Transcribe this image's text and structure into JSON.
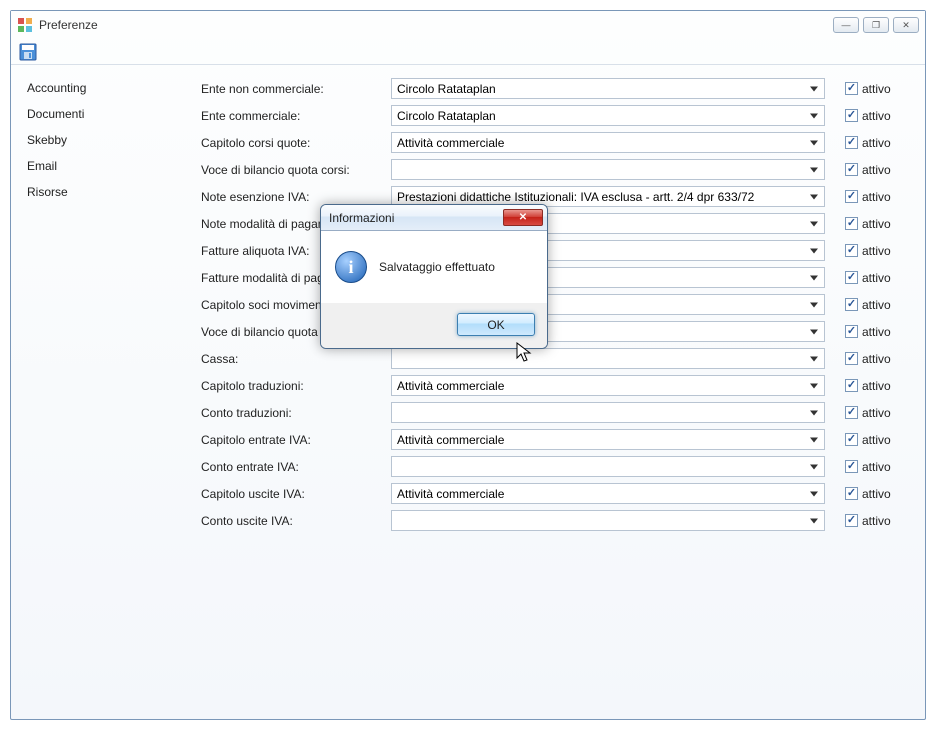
{
  "window": {
    "title": "Preferenze"
  },
  "sidebar": {
    "items": [
      {
        "label": "Accounting"
      },
      {
        "label": "Documenti"
      },
      {
        "label": "Skebby"
      },
      {
        "label": "Email"
      },
      {
        "label": "Risorse"
      }
    ]
  },
  "form": {
    "attivo_label": "attivo",
    "rows": [
      {
        "label": "Ente non commerciale:",
        "value": "Circolo Ratataplan"
      },
      {
        "label": "Ente commerciale:",
        "value": "Circolo Ratataplan"
      },
      {
        "label": "Capitolo corsi quote:",
        "value": "Attività commerciale"
      },
      {
        "label": "Voce di bilancio quota corsi:",
        "value": ""
      },
      {
        "label": "Note esenzione IVA:",
        "value": "Prestazioni didattiche Istituzionali: IVA esclusa - artt. 2/4 dpr 633/72"
      },
      {
        "label": "Note modalità di pagamento:",
        "value": ""
      },
      {
        "label": "Fatture aliquota IVA:",
        "value": ""
      },
      {
        "label": "Fatture modalità di pagamento:",
        "value": ""
      },
      {
        "label": "Capitolo soci movimenti:",
        "value": ""
      },
      {
        "label": "Voce di bilancio quota associativa:",
        "value": ""
      },
      {
        "label": "Cassa:",
        "value": ""
      },
      {
        "label": "Capitolo traduzioni:",
        "value": "Attività commerciale"
      },
      {
        "label": "Conto traduzioni:",
        "value": ""
      },
      {
        "label": "Capitolo entrate IVA:",
        "value": "Attività commerciale"
      },
      {
        "label": "Conto entrate IVA:",
        "value": ""
      },
      {
        "label": "Capitolo uscite IVA:",
        "value": "Attività commerciale"
      },
      {
        "label": "Conto uscite IVA:",
        "value": ""
      }
    ]
  },
  "dialog": {
    "title": "Informazioni",
    "message": "Salvataggio effettuato",
    "ok": "OK"
  }
}
